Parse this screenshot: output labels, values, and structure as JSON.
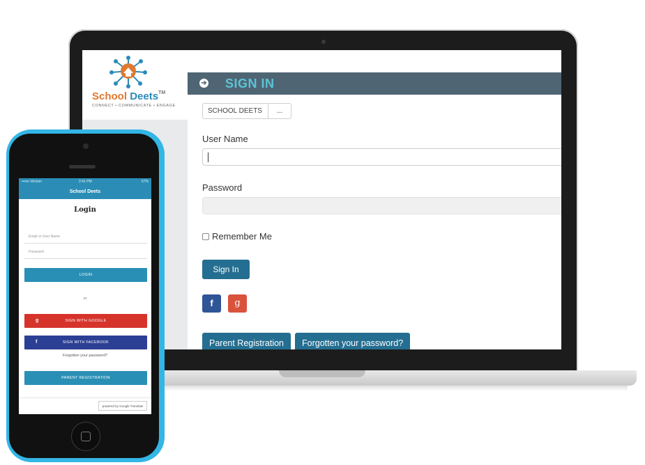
{
  "desktop": {
    "logo": {
      "brand_part1": "School",
      "brand_part2": "Deets",
      "trademark": "TM",
      "tagline": "CONNECT • COMMUNICATE • ENGAGE"
    },
    "header": {
      "title": "SIGN IN"
    },
    "breadcrumb": {
      "items": [
        "SCHOOL DEETS",
        "..."
      ]
    },
    "form": {
      "username_label": "User Name",
      "username_value": "",
      "password_label": "Password",
      "remember_label": "Remember Me",
      "signin_button": "Sign In",
      "facebook_icon": "f",
      "google_icon": "g",
      "parent_registration_button": "Parent Registration",
      "forgot_password_button": "Forgotten your password?"
    },
    "colors": {
      "header_bg": "#4f6574",
      "header_title": "#5cc4d6",
      "button_bg": "#246e91",
      "facebook": "#2f5596",
      "google": "#d9523c"
    }
  },
  "mobile": {
    "status": {
      "carrier": "•••oo Verizon",
      "time": "2:41 PM",
      "battery": "67%"
    },
    "app_title": "School Deets",
    "login_title": "Login",
    "email_placeholder": "Email or User Name",
    "password_placeholder": "Password",
    "login_button": "LOGIN",
    "or_text": "or",
    "google_button": "SIGN WITH GOOGLE",
    "google_icon": "g",
    "facebook_button": "SIGN WITH FACEBOOK",
    "facebook_icon": "f",
    "forgot_link": "Forgotten your password?",
    "parent_registration_button": "PARENT REGISTRATION",
    "translate_badge": "powered by Google Translate",
    "colors": {
      "app_bar": "#2b8db5",
      "google": "#d6332b",
      "facebook": "#2b3f94",
      "login": "#2a8fb5"
    }
  }
}
